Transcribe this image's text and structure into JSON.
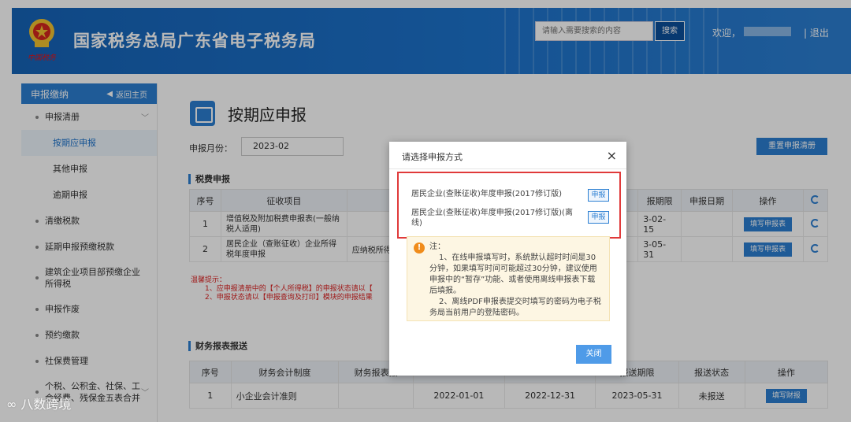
{
  "header": {
    "site_title": "国家税务总局广东省电子税务局",
    "seal_text": "中国税务",
    "search_placeholder": "请输入需要搜索的内容",
    "search_button": "搜索",
    "welcome": "欢迎，",
    "logout": "| 退出"
  },
  "sidebar": {
    "title": "申报缴纳",
    "back_home": "返回主页",
    "items": [
      {
        "label": "申报清册"
      },
      {
        "label": "按期应申报"
      },
      {
        "label": "其他申报"
      },
      {
        "label": "逾期申报"
      },
      {
        "label": "清缴税款"
      },
      {
        "label": "延期申报预缴税款"
      },
      {
        "label": "建筑企业项目部预缴企业所得税"
      },
      {
        "label": "申报作废"
      },
      {
        "label": "预约缴款"
      },
      {
        "label": "社保费管理"
      },
      {
        "label": "个税、公积金、社保、工会经费、残保金五表合并"
      }
    ]
  },
  "main": {
    "page_title": "按期应申报",
    "period_label": "申报月份：",
    "period_value": "2023-02",
    "reset_button": "重置申报清册",
    "tax_section": "税费申报",
    "tax_headers": [
      "序号",
      "征收项目",
      "",
      "报期限",
      "申报日期",
      "操作",
      ""
    ],
    "tax_rows": [
      {
        "no": "1",
        "item": "增值税及附加税费申报表(一般纳税人适用)",
        "extra": "",
        "deadline": "3-02-15",
        "date": "",
        "op": "填写申报表"
      },
      {
        "no": "2",
        "item": "居民企业（查账征收）企业所得税年度申报",
        "extra": "应纳税所得",
        "deadline": "3-05-31",
        "date": "",
        "op": "填写申报表"
      }
    ],
    "tips_title": "温馨提示：",
    "tips_line1": "1、应申报清册中的【个人所得税】的申报状态请以【",
    "tips_line2": "2、申报状态请以【申报查询及打印】模块的申报结果",
    "finance_section": "财务报表报送",
    "fin_headers": [
      "序号",
      "财务会计制度",
      "财务报表报",
      "",
      "",
      "报送期限",
      "报送状态",
      "操作"
    ],
    "fin_rows": [
      {
        "no": "1",
        "system": "小企业会计准则",
        "report": "",
        "start": "2022-01-01",
        "end": "2022-12-31",
        "deadline": "2023-05-31",
        "status": "未报送",
        "op": "填写财报"
      }
    ]
  },
  "modal": {
    "title": "请选择申报方式",
    "close_x": "×",
    "option1": "居民企业(查账征收)年度申报(2017修订版)",
    "option2": "居民企业(查账征收)年度申报(2017修订版)(离线)",
    "option_button": "申报",
    "note_title": "注：",
    "note1": "1、在线申报填写时，系统默认超时时间是30分钟，如果填写时间可能超过30分钟，建议使用申报中的“暂存”功能、或者使用离线申报表下载后填报。",
    "note2": "2、离线PDF申报表提交时填写的密码为电子税务局当前用户的登陆密码。",
    "close_button": "关闭"
  },
  "watermark": "八数跨境",
  "colors": {
    "brand": "#1d73cc",
    "highlight": "#e03a3a",
    "note_bg": "#fdf6e3"
  }
}
